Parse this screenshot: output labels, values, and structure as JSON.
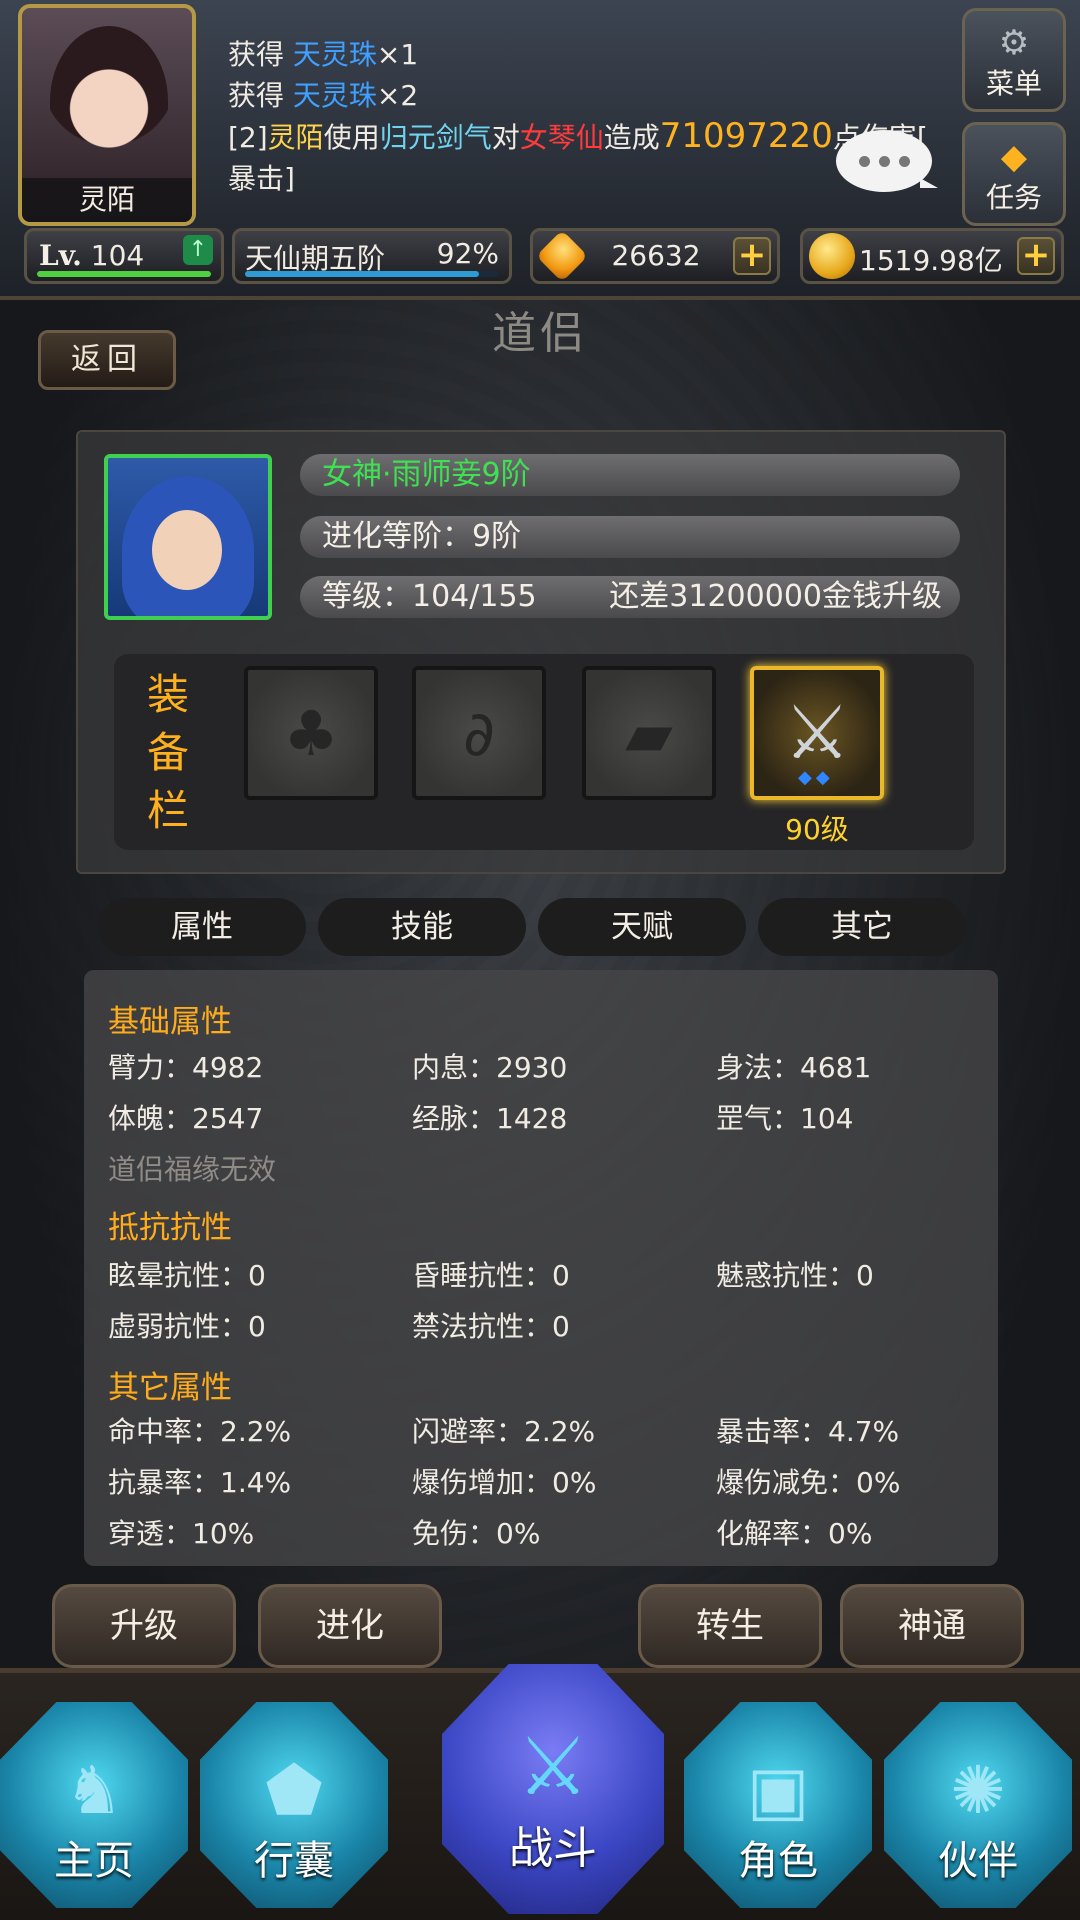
{
  "header": {
    "player_name": "灵陌",
    "chat": {
      "line1": {
        "prefix": "获得 ",
        "item": "天灵珠",
        "count": "×1"
      },
      "line2": {
        "prefix": "获得 ",
        "item": "天灵珠",
        "count": "×2"
      },
      "line3": {
        "tag": "[2]",
        "actor": "灵陌",
        "use": "使用",
        "skill": "归元剑气",
        "to": "对",
        "target": "女琴仙",
        "cause": "造成",
        "damage": "71097220",
        "tail": "点伤害[",
        "crit": "暴击]"
      }
    },
    "menu_label": "菜单",
    "task_label": "任务",
    "level_prefix": "Lv.",
    "level_value": "104",
    "realm": "天仙期五阶",
    "realm_progress": "92%",
    "realm_progress_value": 0.92,
    "diamonds": "26632",
    "gold": "1519.98亿"
  },
  "page": {
    "back_label": "返回",
    "title": "道侣"
  },
  "partner": {
    "name": "女神·雨师妾9阶",
    "evolution": "进化等阶：9阶",
    "level": "等级：104/155",
    "upgrade_cost": "还差31200000金钱升级",
    "equip_label": [
      "装",
      "备",
      "栏"
    ],
    "weapon_level": "90级"
  },
  "tabs": [
    "属性",
    "技能",
    "天赋",
    "其它"
  ],
  "attributes": {
    "basic_title": "基础属性",
    "basic": [
      "臂力：4982",
      "内息：2930",
      "身法：4681",
      "体魄：2547",
      "经脉：1428",
      "罡气：104"
    ],
    "fortune_note": "道侣福缘无效",
    "resist_title": "抵抗抗性",
    "resist": [
      "眩晕抗性：0",
      "昏睡抗性：0",
      "魅惑抗性：0",
      "虚弱抗性：0",
      "禁法抗性：0"
    ],
    "other_title": "其它属性",
    "other": [
      "命中率：2.2%",
      "闪避率：2.2%",
      "暴击率：4.7%",
      "抗暴率：1.4%",
      "爆伤增加：0%",
      "爆伤减免：0%",
      "穿透：10%",
      "免伤：0%",
      "化解率：0%"
    ]
  },
  "actions": [
    "升级",
    "进化",
    "转生",
    "神通"
  ],
  "nav": [
    "主页",
    "行囊",
    "战斗",
    "角色",
    "伙伴"
  ],
  "colors": {
    "accent_orange": "#ffac1c",
    "partner_green": "#3fe052",
    "damage_gold": "#ffb21f"
  }
}
